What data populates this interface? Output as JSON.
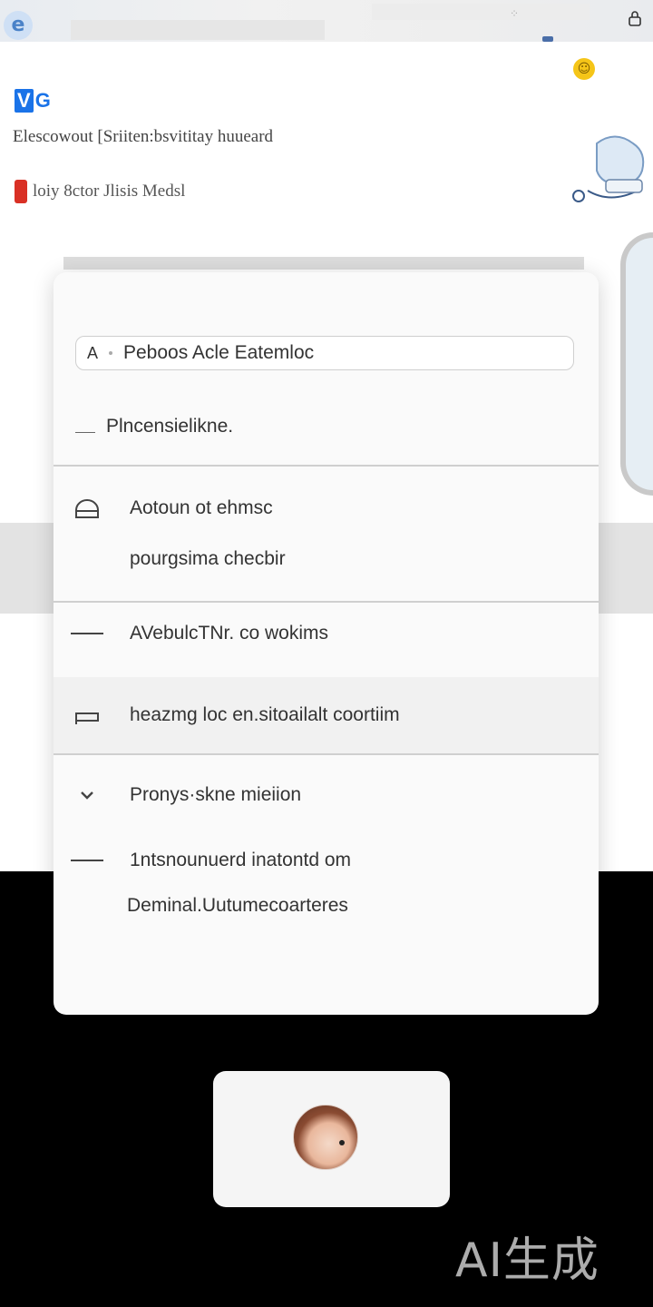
{
  "status_bar": {
    "browser_icon": "e",
    "lock_icon": "lock-icon"
  },
  "background_page": {
    "brand": "G",
    "brand_badge": "V",
    "headline": "Elescowout [Sriiten:bsvititay huueard",
    "subline": "loiy 8ctor Jlisis Medsl",
    "coin_glyph": "☺"
  },
  "dialog": {
    "search": {
      "prefix": "A",
      "value": "Peboos Acle Eatemloc"
    },
    "items": [
      {
        "label": "Plncensielikne.",
        "icon": "line-icon"
      },
      {
        "label": "Aotoun ot ehmsc",
        "icon": "profile-icon"
      },
      {
        "label": "pourgsima checbir",
        "icon": ""
      },
      {
        "label": "AVebulcTNr. co wokims",
        "icon": "dash-icon"
      },
      {
        "label": "heazmg loc en.sitoailalt coortiim",
        "icon": "bed-icon"
      },
      {
        "label": "Pronys·skne mieiion",
        "icon": "chevron-down-icon"
      },
      {
        "label": "1ntsnounuerd inatontd om",
        "icon": "dash-icon"
      },
      {
        "label": "Deminal.Uutumecoarteres",
        "icon": ""
      }
    ]
  },
  "watermark": "AI生成",
  "colors": {
    "accent": "#1a73e8",
    "tag_red": "#d93025",
    "dialog_bg": "#fafafa",
    "backdrop": "#000000"
  }
}
